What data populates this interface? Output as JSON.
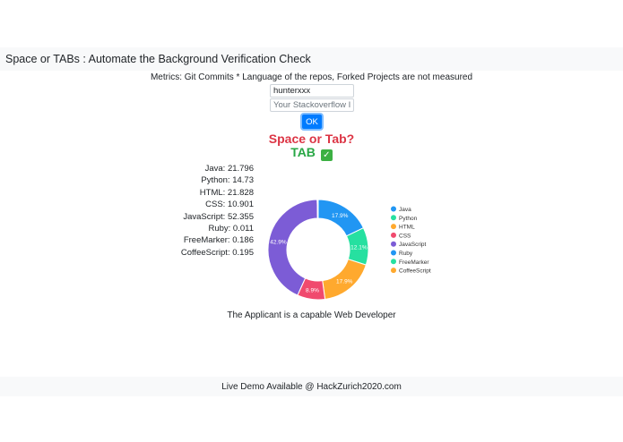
{
  "navbar": {
    "title": "Space or TABs : Automate the Background Verification Check"
  },
  "form": {
    "metrics_note": "Metrics: Git Commits * Language of the repos, Forked Projects are not measured",
    "username_value": "hunterxxx",
    "stackoverflow_placeholder": "Your Stackoverflow ID",
    "ok_label": "OK"
  },
  "result": {
    "question": "Space or Tab?",
    "answer": "TAB",
    "answer_icon": "check-mark-icon",
    "verdict": "The Applicant is a capable Web Developer"
  },
  "stats": [
    {
      "text": "Java: 21.796"
    },
    {
      "text": "Python: 14.73"
    },
    {
      "text": "HTML: 21.828"
    },
    {
      "text": "CSS: 10.901"
    },
    {
      "text": "JavaScript: 52.355"
    },
    {
      "text": "Ruby: 0.011"
    },
    {
      "text": "FreeMarker: 0.186"
    },
    {
      "text": "CoffeeScript: 0.195"
    }
  ],
  "chart_data": {
    "type": "pie",
    "donut": true,
    "legend_position": "right",
    "categories": [
      "Java",
      "Python",
      "HTML",
      "CSS",
      "JavaScript",
      "Ruby",
      "FreeMarker",
      "CoffeeScript"
    ],
    "values": [
      21.796,
      14.73,
      21.828,
      10.901,
      52.355,
      0.011,
      0.186,
      0.195
    ],
    "slice_labels": [
      "17.9%",
      "12.1%",
      "17.9%",
      "8.9%",
      "42.9%",
      "",
      "",
      ""
    ],
    "colors": [
      "#2196f3",
      "#26e0a0",
      "#ffa92e",
      "#f04a6e",
      "#7c5cd6",
      "#2196f3",
      "#26e0a0",
      "#ffa92e"
    ]
  },
  "footer": {
    "text": "Live Demo Available @ HackZurich2020.com"
  }
}
